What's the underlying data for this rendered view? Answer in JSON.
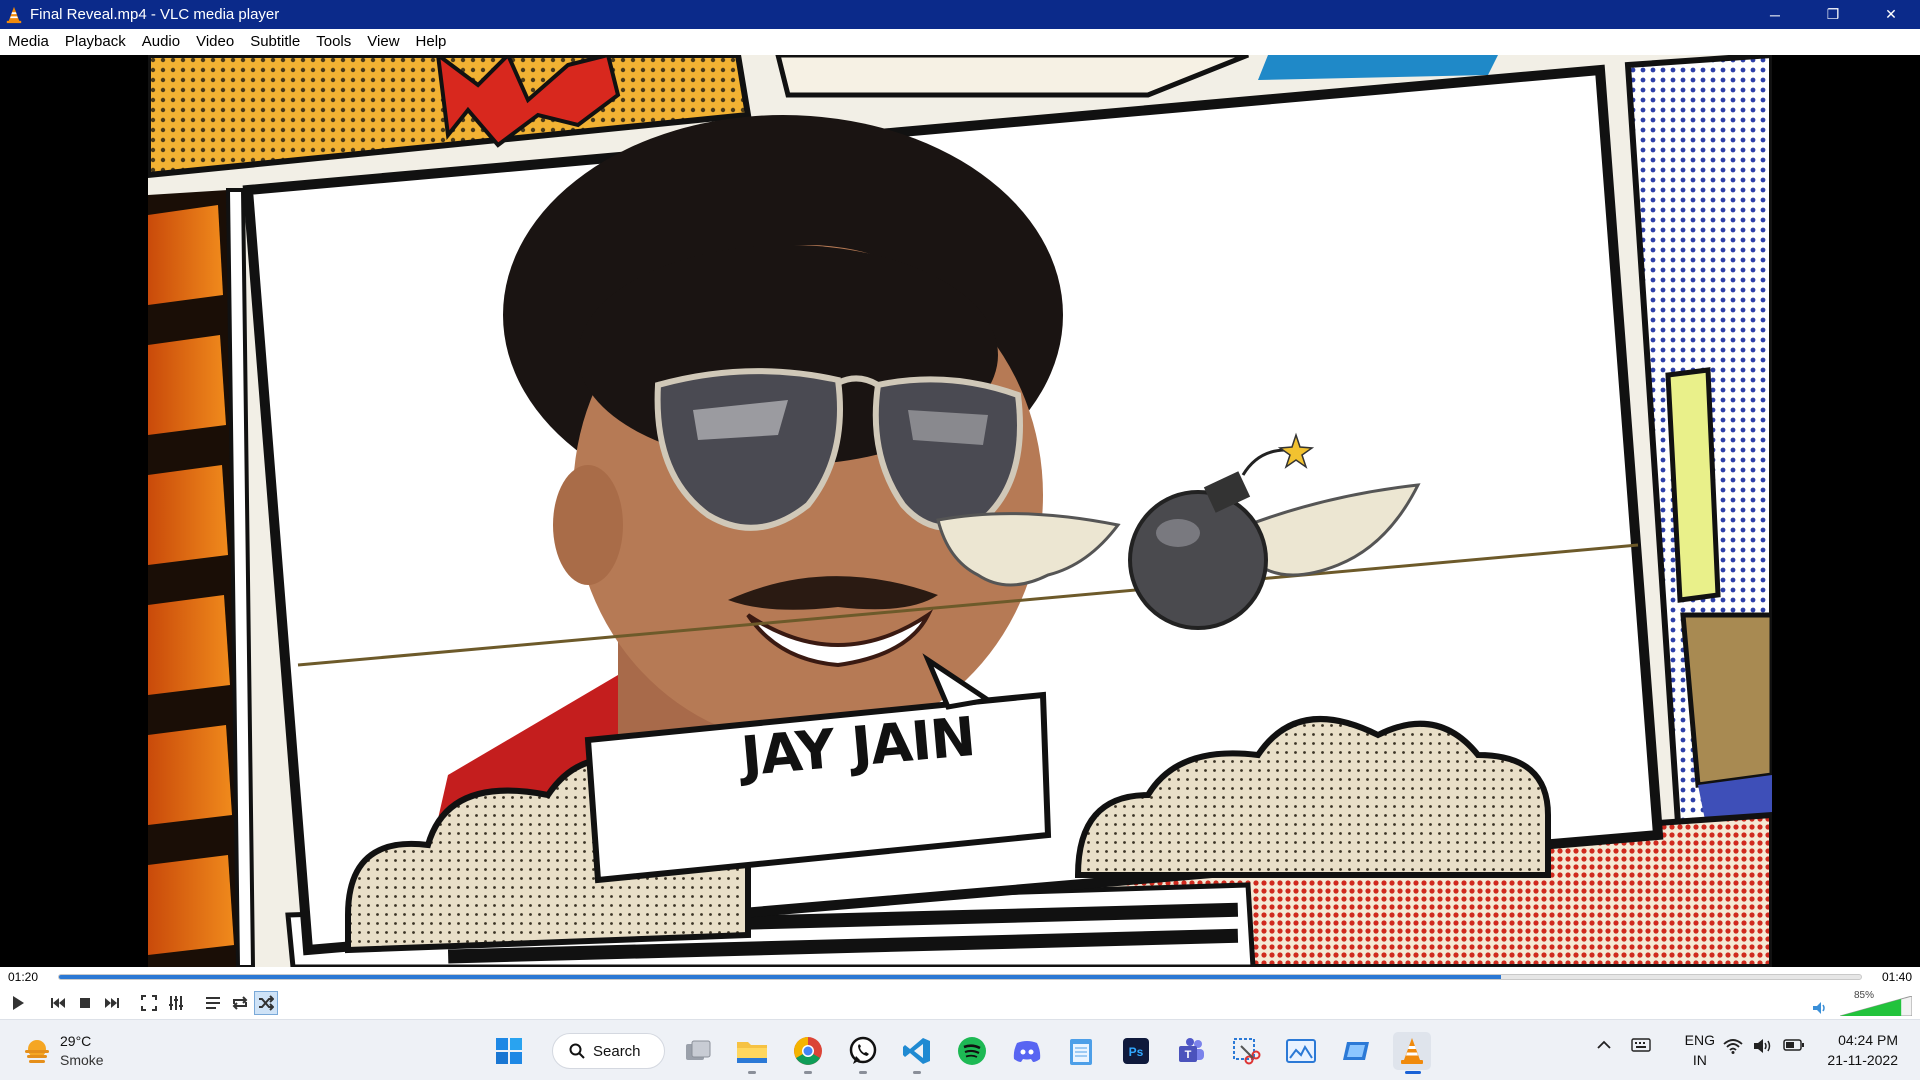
{
  "window": {
    "title": "Final Reveal.mp4 - VLC media player",
    "controls": {
      "minimize": "─",
      "restore": "❐",
      "close": "✕"
    }
  },
  "menu": [
    "Media",
    "Playback",
    "Audio",
    "Video",
    "Subtitle",
    "Tools",
    "View",
    "Help"
  ],
  "video": {
    "caption": "JAY JAIN"
  },
  "playback": {
    "current_time": "01:20",
    "total_time": "01:40",
    "progress": 0.8,
    "volume_label": "85%",
    "volume": 0.85,
    "shuffle_active": true
  },
  "taskbar": {
    "weather": {
      "temp": "29°C",
      "condition": "Smoke"
    },
    "search_label": "Search",
    "apps": [
      "start",
      "search",
      "task-view",
      "file-explorer",
      "chrome",
      "whatsapp",
      "vscode",
      "spotify",
      "discord",
      "notepad",
      "photoshop",
      "teams",
      "snipping-tool",
      "photos",
      "remote",
      "vlc"
    ],
    "language": {
      "line1": "ENG",
      "line2": "IN"
    },
    "clock": {
      "time": "04:24 PM",
      "date": "21-11-2022"
    }
  },
  "colors": {
    "titlebar": "#0b2a8a",
    "seek_fill": "#2b78d4",
    "volume_fill": "#22c33c",
    "taskbar": "#eef1f6"
  }
}
